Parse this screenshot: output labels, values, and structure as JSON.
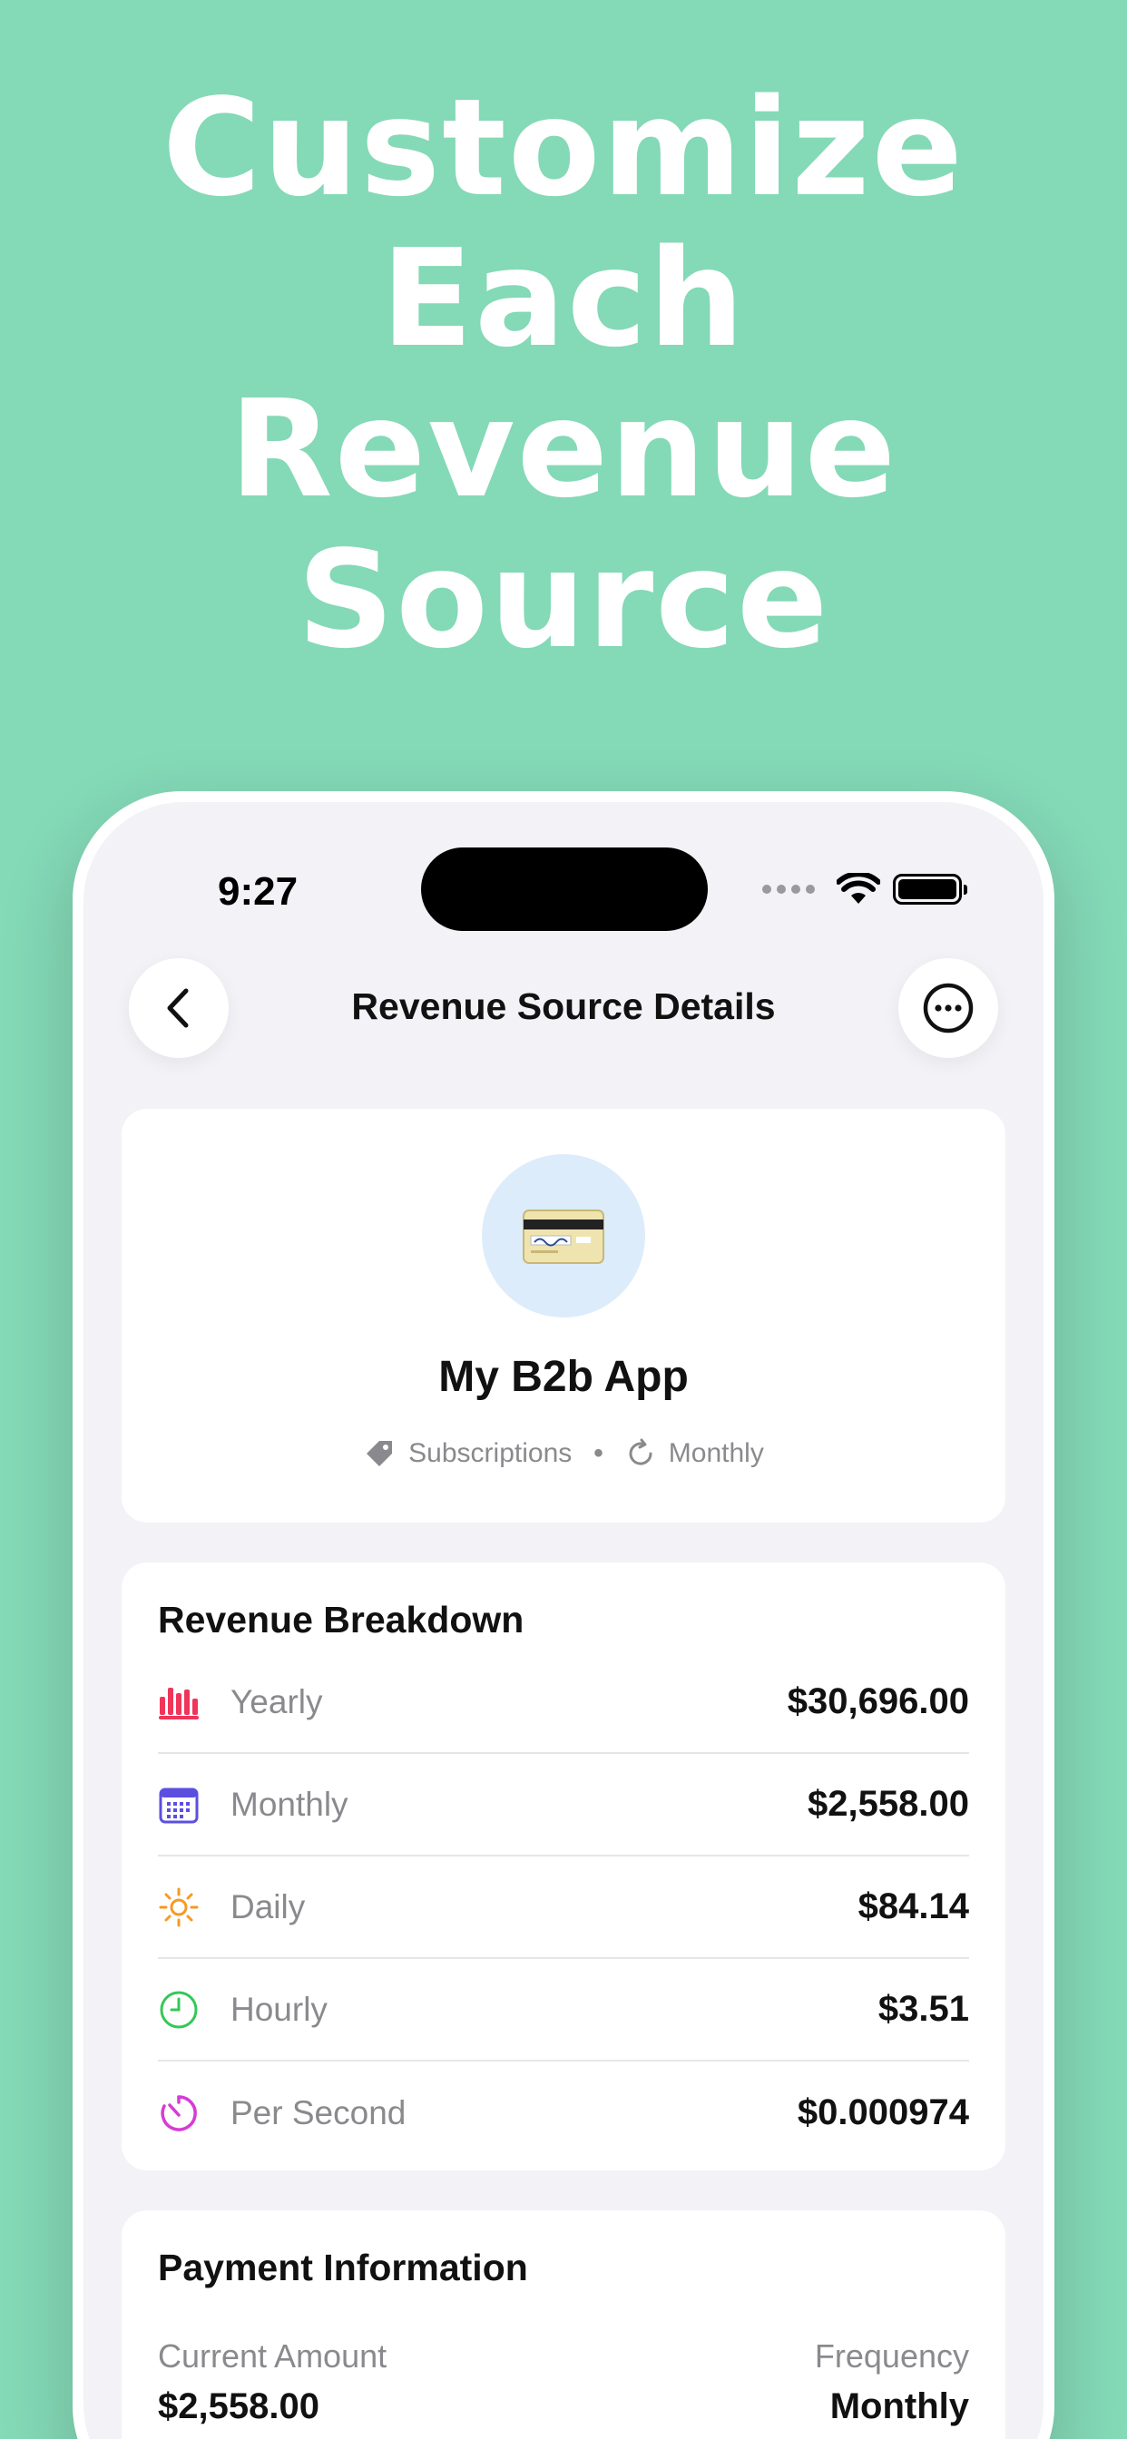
{
  "headline": {
    "line1": "Customize",
    "line2": "Each",
    "line3": "Revenue",
    "line4": "Source"
  },
  "status_bar": {
    "time": "9:27"
  },
  "nav": {
    "title": "Revenue Source Details",
    "back_icon": "chevron-left-icon",
    "more_icon": "ellipsis-circle-icon"
  },
  "source": {
    "name": "My B2b App",
    "icon": "credit-card-icon",
    "category": "Subscriptions",
    "frequency": "Monthly"
  },
  "breakdown": {
    "title": "Revenue Breakdown",
    "rows": [
      {
        "label": "Yearly",
        "value": "$30,696.00",
        "icon": "bar-chart-icon",
        "color": "#f0355a"
      },
      {
        "label": "Monthly",
        "value": "$2,558.00",
        "icon": "calendar-icon",
        "color": "#5b4fe0"
      },
      {
        "label": "Daily",
        "value": "$84.14",
        "icon": "sun-icon",
        "color": "#f59a23"
      },
      {
        "label": "Hourly",
        "value": "$3.51",
        "icon": "clock-icon",
        "color": "#34c759"
      },
      {
        "label": "Per Second",
        "value": "$0.000974",
        "icon": "timer-icon",
        "color": "#d63cd6"
      }
    ]
  },
  "payment": {
    "title": "Payment Information",
    "current_amount_label": "Current Amount",
    "current_amount_value": "$2,558.00",
    "frequency_label": "Frequency",
    "frequency_value": "Monthly"
  },
  "colors": {
    "background": "#84d9b7",
    "screen": "#f2f2f7",
    "card": "#ffffff",
    "avatar_bg": "#dcecfb"
  }
}
